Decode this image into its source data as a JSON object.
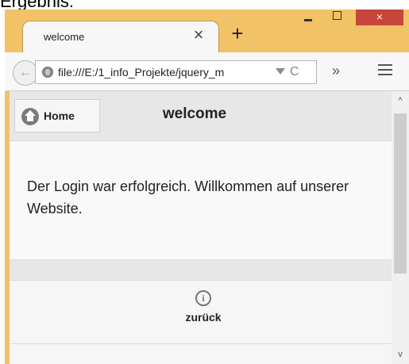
{
  "page_caption": "Ergebnis:",
  "window": {
    "controls": {
      "close_symbol": "×"
    },
    "tab": {
      "title": "welcome",
      "close_symbol": "×"
    },
    "new_tab_symbol": "+"
  },
  "navbar": {
    "back_symbol": "←",
    "url": "file:///E:/1_info_Projekte/jquery_m",
    "reload_symbol": "C",
    "overflow_symbol": "»"
  },
  "page": {
    "header": {
      "home_label": "Home",
      "title": "welcome"
    },
    "message": "Der Login war erfolgreich. Willkommen auf unserer Website.",
    "footer": {
      "info_symbol": "i",
      "back_label": "zurück"
    }
  },
  "scrollbar": {
    "up_symbol": "^",
    "down_symbol": "v"
  },
  "colors": {
    "chrome_frame": "#f2c267",
    "close_button": "#c7453a",
    "header_bg": "#e7e7e7"
  },
  "icons": [
    "globe-icon",
    "dropmarker-icon",
    "reload-icon",
    "menu-icon",
    "home-icon",
    "info-icon"
  ]
}
